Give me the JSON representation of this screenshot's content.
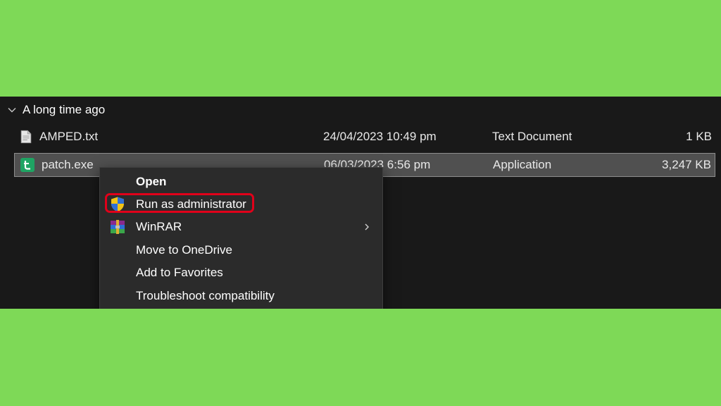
{
  "group": {
    "label": "A long time ago",
    "icon": "chevron-down-icon"
  },
  "files": [
    {
      "name": "AMPED.txt",
      "modified": "24/04/2023 10:49 pm",
      "type": "Text Document",
      "size": "1 KB",
      "icon": "text-file-icon",
      "selected": false
    },
    {
      "name": "patch.exe",
      "modified": "06/03/2023 6:56 pm",
      "type": "Application",
      "size": "3,247 KB",
      "icon": "application-icon",
      "selected": true
    }
  ],
  "context_menu": {
    "items": [
      {
        "label": "Open",
        "bold": true
      },
      {
        "label": "Run as administrator",
        "icon": "uac-shield-icon",
        "highlighted": true
      },
      {
        "label": "WinRAR",
        "icon": "winrar-icon",
        "has_submenu": true
      },
      {
        "label": "Move to OneDrive"
      },
      {
        "label": "Add to Favorites"
      },
      {
        "label": "Troubleshoot compatibility"
      }
    ]
  },
  "colors": {
    "background": "#7ed957",
    "explorer_bg": "#191919",
    "menu_bg": "#2b2b2b",
    "selection_bg": "#505050",
    "highlight_border": "#e1001a"
  }
}
